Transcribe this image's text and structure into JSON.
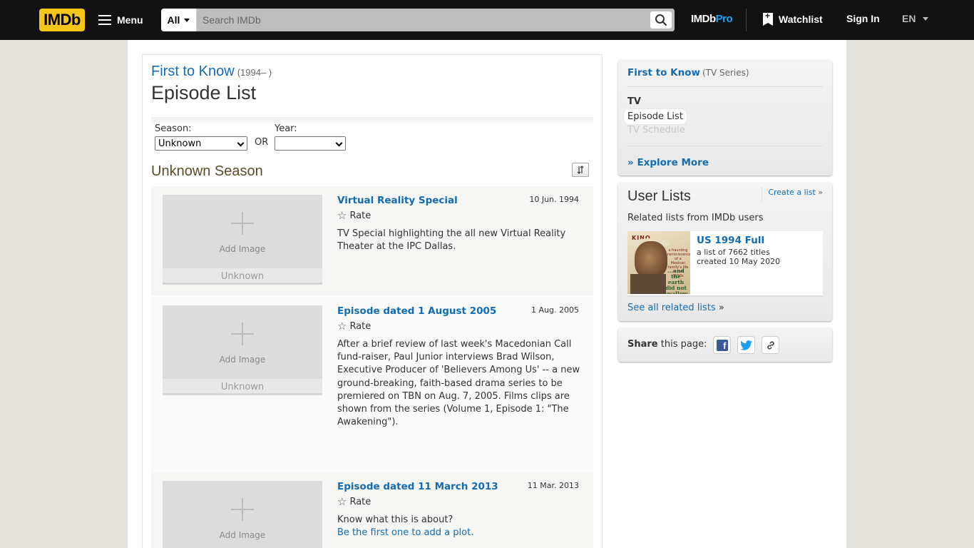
{
  "header": {
    "logo": "IMDb",
    "menu_label": "Menu",
    "search_category": "All",
    "search_placeholder": "Search IMDb",
    "imdbpro_a": "IMDb",
    "imdbpro_b": "Pro",
    "watchlist_label": "Watchlist",
    "signin_label": "Sign In",
    "language": "EN"
  },
  "main": {
    "series_title": "First to Know",
    "series_years": "(1994– )",
    "heading": "Episode List",
    "season_label": "Season:",
    "season_value": "Unknown",
    "or_label": "OR",
    "year_label": "Year:",
    "year_value": "",
    "season_heading": "Unknown Season",
    "episodes": [
      {
        "title": "Virtual Reality Special",
        "date": "10 Jun. 1994",
        "rate_label": "Rate",
        "add_image": "Add Image",
        "image_caption": "Unknown",
        "plot": "TV Special highlighting the all new Virtual Reality Theater at the IPC Dallas."
      },
      {
        "title": "Episode dated 1 August 2005",
        "date": "1 Aug. 2005",
        "rate_label": "Rate",
        "add_image": "Add Image",
        "image_caption": "Unknown",
        "plot": "After a brief review of last week's Macedonian Call fund-raiser, Paul Junior interviews Brad Wilson, Executive Producer of 'Believers Among Us' -- a new ground-breaking, faith-based drama series to be premiered on TBN on Aug. 7, 2005. Films clips are shown from the series (Volume 1, Episode 1: \"The Awakening\")."
      },
      {
        "title": "Episode dated 11 March 2013",
        "date": "11 Mar. 2013",
        "rate_label": "Rate",
        "add_image": "Add Image",
        "plot_prompt": "Know what this is about?",
        "plot_link": "Be the first one to add a plot."
      }
    ]
  },
  "sidebar": {
    "series_title": "First to Know",
    "series_type": "(TV Series)",
    "tv_heading": "TV",
    "episode_list_link": "Episode List",
    "tv_schedule_link": "TV Schedule",
    "explore_more": "Explore More",
    "user_lists_heading": "User Lists",
    "create_list": "Create a list",
    "create_list_suffix": "»",
    "related_text": "Related lists from IMDb users",
    "list_name": "US 1994 Full",
    "list_count": "a list of 7662 titles",
    "list_created": "created 10 May 2020",
    "poster_brand": "KINO",
    "poster_title": "...and the earth did not swallow",
    "poster_tagline": "a haunting reminiscence of a Mexican family's life in the 1950s",
    "see_all": "See all related lists",
    "see_all_suffix": "»",
    "share_bold": "Share",
    "share_rest": " this page:"
  }
}
